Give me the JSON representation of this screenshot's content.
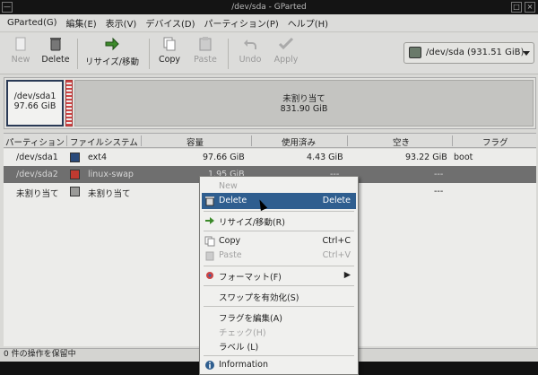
{
  "title": "/dev/sda - GParted",
  "menubar": [
    "GParted(G)",
    "編集(E)",
    "表示(V)",
    "デバイス(D)",
    "パーティション(P)",
    "ヘルプ(H)"
  ],
  "toolbar": {
    "new": "New",
    "delete": "Delete",
    "resize": "リサイズ/移動",
    "copy": "Copy",
    "paste": "Paste",
    "undo": "Undo",
    "apply": "Apply"
  },
  "device_selector": "/dev/sda  (931.51 GiB)",
  "map": {
    "p1_name": "/dev/sda1",
    "p1_size": "97.66 GiB",
    "unallocated_label": "未割り当て",
    "unallocated_size": "831.90 GiB"
  },
  "columns": [
    "パーティション",
    "ファイルシステム",
    "容量",
    "使用済み",
    "空き",
    "フラグ"
  ],
  "rows": [
    {
      "partition": "/dev/sda1",
      "filesystem": "ext4",
      "size": "97.66 GiB",
      "used": "4.43 GiB",
      "free": "93.22 GiB",
      "flags": "boot",
      "color": "#2a4a7a"
    },
    {
      "partition": "/dev/sda2",
      "filesystem": "linux-swap",
      "size": "1.95 GiB",
      "used": "---",
      "free": "---",
      "flags": "",
      "color": "#c03a30"
    },
    {
      "partition": "未割り当て",
      "filesystem": "未割り当て",
      "size": "",
      "used": "",
      "free": "---",
      "flags": "",
      "color": "#9a9a98"
    }
  ],
  "status": "0 件の操作を保留中",
  "context_menu": {
    "new": "New",
    "delete": "Delete",
    "delete_key": "Delete",
    "resize": "リサイズ/移動(R)",
    "copy": "Copy",
    "copy_key": "Ctrl+C",
    "paste": "Paste",
    "paste_key": "Ctrl+V",
    "format": "フォーマット(F)",
    "swapon": "スワップを有効化(S)",
    "flags": "フラグを編集(A)",
    "check": "チェック(H)",
    "label": "ラベル (L)",
    "info": "Information"
  }
}
